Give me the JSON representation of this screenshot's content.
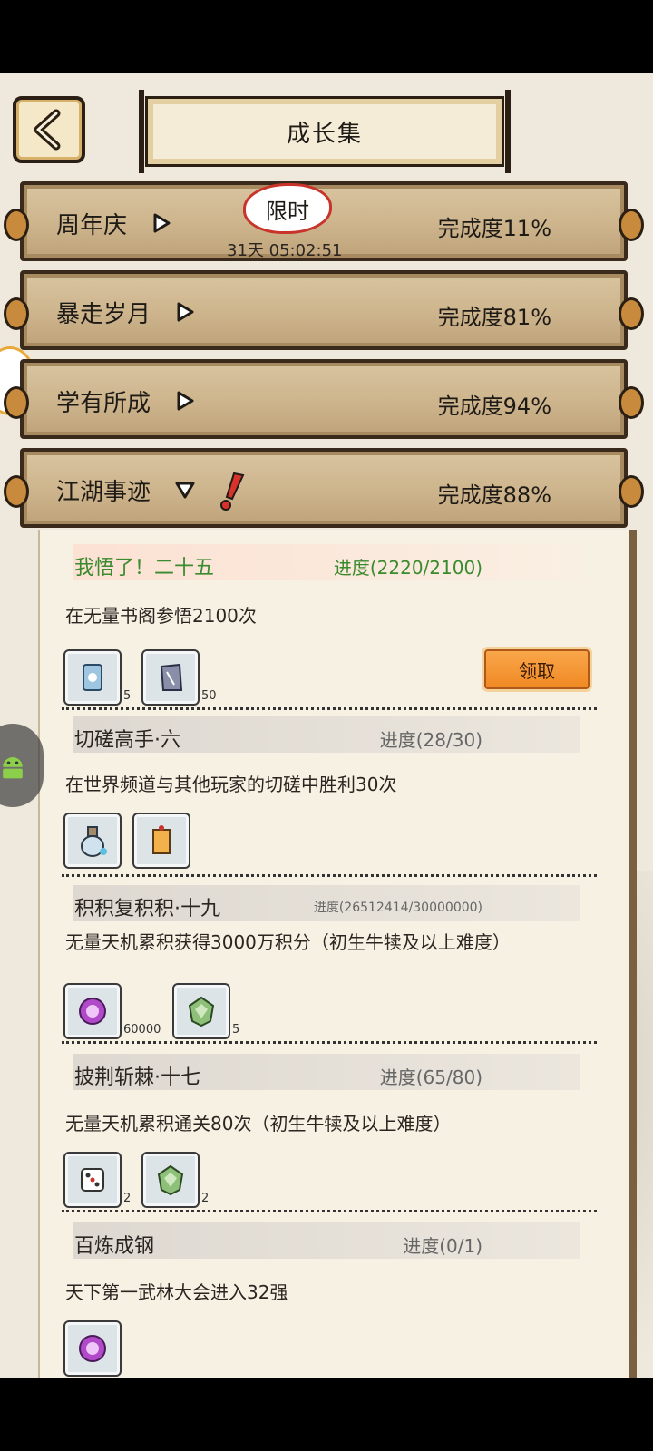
{
  "header": {
    "title": "成长集",
    "back_icon": "back-arrow-icon"
  },
  "categories": [
    {
      "name": "周年庆",
      "completion": "完成度11%",
      "limited_badge": "限时",
      "timer": "31天 05:02:51",
      "expanded": false
    },
    {
      "name": "暴走岁月",
      "completion": "完成度81%",
      "expanded": false
    },
    {
      "name": "学有所成",
      "completion": "完成度94%",
      "expanded": false
    },
    {
      "name": "江湖事迹",
      "completion": "完成度88%",
      "expanded": true,
      "has_alert": true
    }
  ],
  "tasks": [
    {
      "title": "我悟了！二十五",
      "progress": "进度(2220/2100)",
      "desc": "在无量书阁参悟2100次",
      "claim_label": "领取",
      "rewards": [
        {
          "icon": "scroll-token-icon",
          "count": "5"
        },
        {
          "icon": "paper-slip-icon",
          "count": "50"
        }
      ]
    },
    {
      "title": "切磋高手·六",
      "progress": "进度(28/30)",
      "desc": "在世界频道与其他玩家的切磋中胜利30次",
      "rewards": [
        {
          "icon": "potion-bottle-icon",
          "count": ""
        },
        {
          "icon": "name-card-icon",
          "count": ""
        }
      ]
    },
    {
      "title": "积积复积积·十九",
      "progress": "进度(26512414/30000000)",
      "desc": "无量天机累积获得3000万积分（初生牛犊及以上难度）",
      "rewards": [
        {
          "icon": "purple-orb-icon",
          "count": "60000"
        },
        {
          "icon": "green-jade-icon",
          "count": "5"
        }
      ]
    },
    {
      "title": "披荆斩棘·十七",
      "progress": "进度(65/80)",
      "desc": "无量天机累积通关80次（初生牛犊及以上难度）",
      "rewards": [
        {
          "icon": "dice-icon",
          "count": "2"
        },
        {
          "icon": "green-jade-icon",
          "count": "2"
        }
      ]
    },
    {
      "title": "百炼成钢",
      "progress": "进度(0/1)",
      "desc": "天下第一武林大会进入32强",
      "rewards": [
        {
          "icon": "purple-orb-icon",
          "count": ""
        }
      ]
    }
  ],
  "colors": {
    "accent_green": "#3a8a2e",
    "claim_orange": "#f08a24",
    "limited_red": "#c8332a"
  }
}
